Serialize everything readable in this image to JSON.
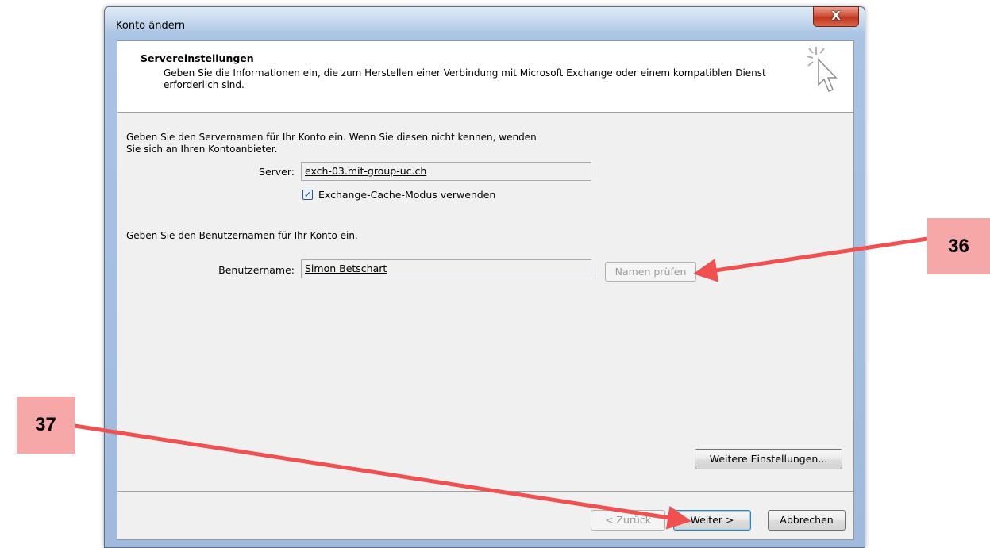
{
  "window": {
    "title": "Konto ändern",
    "close_glyph": "X"
  },
  "header": {
    "title": "Servereinstellungen",
    "description": "Geben Sie die Informationen ein, die zum Herstellen einer Verbindung mit Microsoft Exchange oder einem kompatiblen Dienst erforderlich sind."
  },
  "server_section": {
    "intro_line1": "Geben Sie den Servernamen für Ihr Konto ein. Wenn Sie diesen nicht kennen, wenden",
    "intro_line2": "Sie sich an Ihren Kontoanbieter.",
    "server_label": "Server:",
    "server_value": "exch-03.mit-group-uc.ch",
    "cache_checkbox_label": "Exchange-Cache-Modus verwenden",
    "cache_checked": true
  },
  "user_section": {
    "intro": "Geben Sie den Benutzernamen für Ihr Konto ein.",
    "username_label": "Benutzername:",
    "username_value": "Simon Betschart",
    "check_names_button": "Namen prüfen"
  },
  "buttons": {
    "more_settings": "Weitere Einstellungen...",
    "back": "< Zurück",
    "next": "Weiter >",
    "cancel": "Abbrechen"
  },
  "annotations": {
    "callout_36": "36",
    "callout_37": "37",
    "color": "#f05050"
  }
}
